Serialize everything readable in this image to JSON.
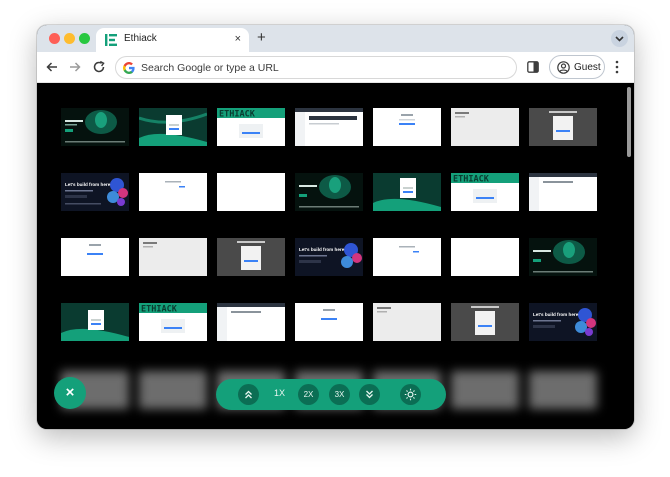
{
  "browser": {
    "tab_title": "Ethiack",
    "tab_close": "×",
    "new_tab": "+",
    "omnibox_placeholder": "Search Google or type a URL",
    "profile_label": "Guest"
  },
  "zoom_controls": {
    "zoom_1x": "1X",
    "zoom_2x": "2X",
    "zoom_3x": "3X",
    "close_symbol": "×"
  },
  "thumbnails": {
    "wordmark": "ETHIACK",
    "hero_heading": "Let's build from here",
    "modal_heading": "Hello, Welcome back"
  },
  "colors": {
    "accent_green": "#14a07a",
    "accent_green_dark": "#0b6e54",
    "tab_bar": "#dde3ea",
    "viewport_bg": "#000000"
  },
  "icons": {
    "favicon": "ethiack-logo-icon",
    "back": "arrow-left-icon",
    "forward": "arrow-right-icon",
    "reload": "reload-icon",
    "search": "google-g-icon",
    "side_panel": "side-panel-icon",
    "profile": "person-circle-icon",
    "menu": "kebab-menu-icon",
    "scroll_up": "double-chevron-up-icon",
    "scroll_down": "double-chevron-down-icon",
    "theme": "sun-icon"
  }
}
